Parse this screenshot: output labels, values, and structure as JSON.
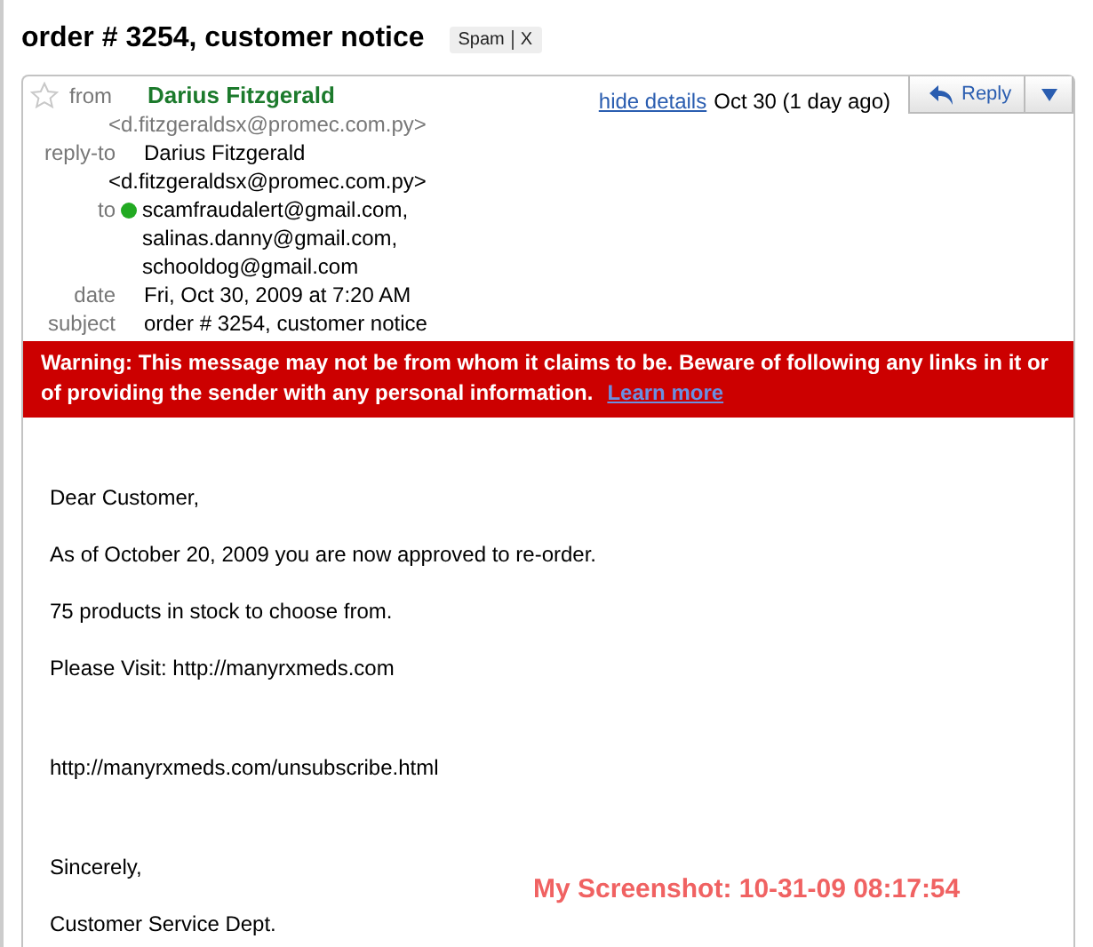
{
  "subject_title": "order # 3254, customer notice",
  "label_chip": {
    "label": "Spam",
    "remove": "X"
  },
  "header": {
    "starred": false,
    "from": {
      "label": "from",
      "name": "Darius Fitzgerald",
      "email": "<d.fitzgeraldsx@promec.com.py>"
    },
    "reply_to": {
      "label": "reply-to",
      "name": "Darius Fitzgerald",
      "email": "<d.fitzgeraldsx@promec.com.py>"
    },
    "to": {
      "label": "to",
      "online": true,
      "recipients": [
        "scamfraudalert@gmail.com,",
        "salinas.danny@gmail.com,",
        "schooldog@gmail.com"
      ]
    },
    "date": {
      "label": "date",
      "value": "Fri, Oct 30, 2009 at 7:20 AM"
    },
    "subject": {
      "label": "subject",
      "value": "order # 3254, customer notice"
    },
    "details_link": "hide details",
    "received": "Oct 30 (1 day ago)",
    "reply_button": "Reply"
  },
  "warning": {
    "text": "Warning: This message may not be from whom it claims to be. Beware of following any links in it or of providing the sender with any personal information.",
    "link": "Learn more"
  },
  "body_sections": [
    [
      "Dear Customer,",
      "As of October 20, 2009 you are now approved to re-order.",
      "75 products in stock to choose from.",
      "Please Visit: http://manyrxmeds.com"
    ],
    [
      "http://manyrxmeds.com/unsubscribe.html"
    ],
    [
      "Sincerely,",
      "Customer Service Dept."
    ]
  ],
  "overlay_caption": "My Screenshot: 10-31-09 08:17:54"
}
